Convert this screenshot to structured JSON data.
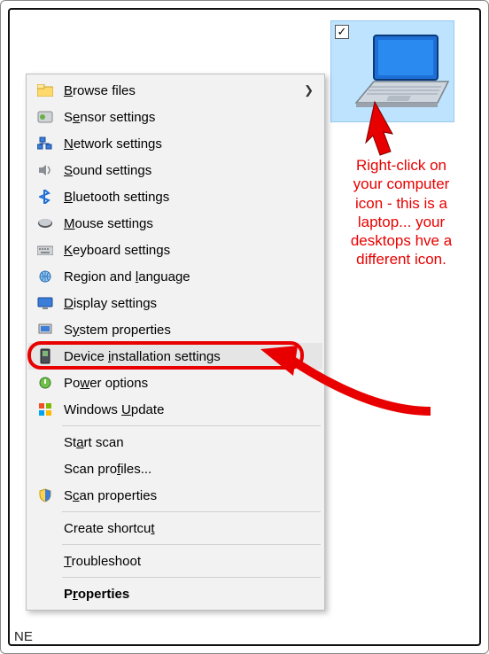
{
  "annotation": "Right-click on your computer icon - this is a laptop... your desktops hve a different icon.",
  "menu": {
    "browse": "Browse files",
    "sensor": "Sensor settings",
    "network": "Network settings",
    "sound": "Sound settings",
    "bluetooth": "Bluetooth settings",
    "mouse": "Mouse settings",
    "keyboard": "Keyboard settings",
    "region": "Region and language",
    "display": "Display settings",
    "system": "System properties",
    "device": "Device installation settings",
    "power": "Power options",
    "update": "Windows Update",
    "startscan": "Start scan",
    "scanprof": "Scan profiles...",
    "scanprop": "Scan properties",
    "shortcut": "Create shortcut",
    "troubleshoot": "Troubleshoot",
    "properties": "Properties"
  },
  "bottom": "NE",
  "colors": {
    "tile": "#bde3ff",
    "red": "#e80000"
  }
}
